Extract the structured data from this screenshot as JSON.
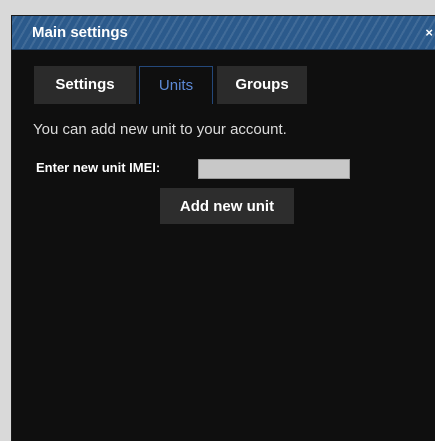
{
  "window": {
    "title": "Main settings",
    "close_label": "×"
  },
  "tabs": [
    {
      "label": "Settings",
      "active": false
    },
    {
      "label": "Units",
      "active": true
    },
    {
      "label": "Groups",
      "active": false
    }
  ],
  "units": {
    "info_text": "You can add new unit to your account.",
    "imei_label": "Enter new unit IMEI:",
    "imei_value": "",
    "add_button_label": "Add new unit"
  },
  "colors": {
    "title_bar": "#2b5a8c",
    "active_tab_text": "#5d8ad6",
    "window_background": "#0f0f0f"
  }
}
